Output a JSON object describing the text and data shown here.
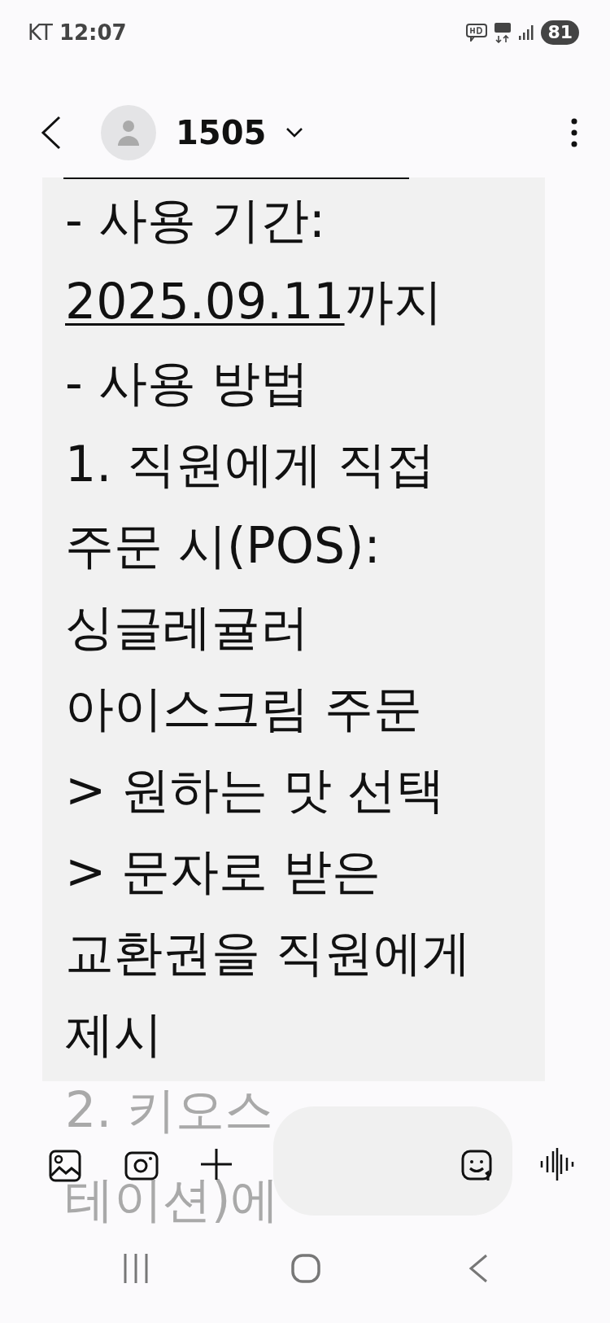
{
  "status_bar": {
    "carrier": "KT",
    "time": "12:07",
    "battery": "81"
  },
  "header": {
    "contact": "1505"
  },
  "message": {
    "lines": [
      [
        {
          "kind": "plain",
          "text": "- 사용 기간:"
        }
      ],
      [
        {
          "kind": "link",
          "text": "2025.09.11"
        },
        {
          "kind": "plain",
          "text": "까지"
        }
      ],
      [
        {
          "kind": "plain",
          "text": "- 사용 방법"
        }
      ],
      [
        {
          "kind": "plain",
          "text": "1. 직원에게 직접"
        }
      ],
      [
        {
          "kind": "plain",
          "text": "주문 시(POS):"
        }
      ],
      [
        {
          "kind": "plain",
          "text": "싱글레귤러"
        }
      ],
      [
        {
          "kind": "plain",
          "text": "아이스크림 주문"
        }
      ],
      [
        {
          "kind": "plain",
          "text": "> 원하는 맛 선택"
        }
      ],
      [
        {
          "kind": "plain",
          "text": "> 문자로 받은"
        }
      ],
      [
        {
          "kind": "plain",
          "text": "교환권을 직원에게"
        }
      ],
      [
        {
          "kind": "plain",
          "text": "제시"
        }
      ]
    ],
    "faded_lines": [
      "2. 키오스",
      "테이션)에"
    ]
  }
}
